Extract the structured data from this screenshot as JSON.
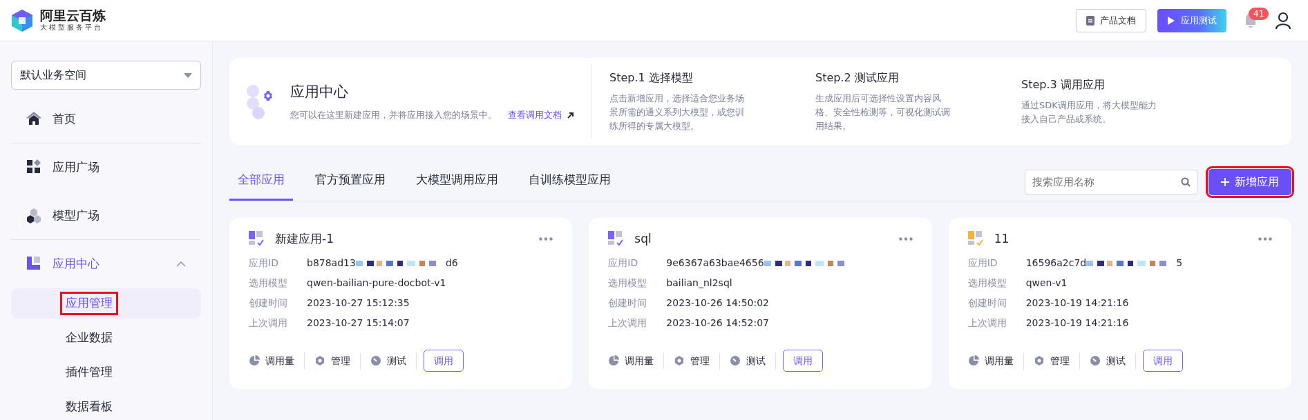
{
  "brand": {
    "name": "阿里云百炼",
    "tagline": "大模型服务平台"
  },
  "topbar": {
    "buttons": [
      {
        "label": "产品文档",
        "kind": "outline"
      },
      {
        "label": "应用测试",
        "kind": "gradient"
      }
    ],
    "notification_count": "41"
  },
  "sidebar": {
    "workspace": "默认业务空间",
    "items": [
      {
        "label": "首页",
        "kind": "home",
        "selected": false,
        "divider_after": true
      },
      {
        "label": "应用广场",
        "kind": "grid",
        "selected": false,
        "divider_after": false
      },
      {
        "label": "模型广场",
        "kind": "cubes",
        "selected": false,
        "divider_after": true
      },
      {
        "label": "应用中心",
        "kind": "app",
        "selected": true,
        "expanded": true,
        "divider_after": false,
        "children": [
          {
            "label": "应用管理",
            "selected": true,
            "annotated": true
          },
          {
            "label": "企业数据",
            "selected": false,
            "annotated": false
          },
          {
            "label": "插件管理",
            "selected": false,
            "annotated": false
          },
          {
            "label": "数据看板",
            "selected": false,
            "annotated": false
          }
        ]
      }
    ]
  },
  "intro": {
    "title": "应用中心",
    "description": "您可以在这里新建应用，并将应用接入您的场景中。",
    "link": "查看调用文档",
    "steps": [
      {
        "title": "Step.1 选择模型",
        "text": "点击新增应用，选择适合您业务场景所需的通义系列大模型，或您训练所得的专属大模型。"
      },
      {
        "title": "Step.2 测试应用",
        "text": "生成应用后可选择性设置内容风格、安全性检测等，可视化测试调用结果。"
      },
      {
        "title": "Step.3 调用应用",
        "text": "通过SDK调用应用，将大模型能力接入自己产品或系统。"
      }
    ]
  },
  "tabs": [
    {
      "label": "全部应用",
      "selected": true
    },
    {
      "label": "官方预置应用",
      "selected": false
    },
    {
      "label": "大模型调用应用",
      "selected": false
    },
    {
      "label": "自训练模型应用",
      "selected": false
    }
  ],
  "search": {
    "placeholder": "搜索应用名称"
  },
  "new_button": {
    "label": "新增应用",
    "annotated": true
  },
  "apps": [
    {
      "name": "新建应用-1",
      "color": "#7b61ff",
      "fields": [
        {
          "label": "应用ID",
          "value": "b878ad13",
          "masked": true,
          "tail": "d6"
        },
        {
          "label": "选用模型",
          "value": "qwen-bailian-pure-docbot-v1",
          "masked": false
        },
        {
          "label": "创建时间",
          "value": "2023-10-27 15:12:35",
          "masked": false
        },
        {
          "label": "上次调用",
          "value": "2023-10-27 15:14:07",
          "masked": false
        }
      ],
      "actions": [
        {
          "kind": "usage",
          "label": "调用量"
        },
        {
          "kind": "manage",
          "label": "管理"
        },
        {
          "kind": "test",
          "label": "测试"
        }
      ],
      "invoke": "调用"
    },
    {
      "name": "sql",
      "color": "#7b61ff",
      "fields": [
        {
          "label": "应用ID",
          "value": "9e6367a63bae4656",
          "masked": true
        },
        {
          "label": "选用模型",
          "value": "bailian_nl2sql",
          "masked": false
        },
        {
          "label": "创建时间",
          "value": "2023-10-26 14:50:02",
          "masked": false
        },
        {
          "label": "上次调用",
          "value": "2023-10-26 14:52:07",
          "masked": false
        }
      ],
      "actions": [
        {
          "kind": "usage",
          "label": "调用量"
        },
        {
          "kind": "manage",
          "label": "管理"
        },
        {
          "kind": "test",
          "label": "测试"
        }
      ],
      "invoke": "调用"
    },
    {
      "name": "11",
      "color": "#f5b335",
      "fields": [
        {
          "label": "应用ID",
          "value": "16596a2c7d",
          "masked": true,
          "tail": "5"
        },
        {
          "label": "选用模型",
          "value": "qwen-v1",
          "masked": false
        },
        {
          "label": "创建时间",
          "value": "2023-10-19 14:21:16",
          "masked": false
        },
        {
          "label": "上次调用",
          "value": "2023-10-19 14:21:16",
          "masked": false
        }
      ],
      "actions": [
        {
          "kind": "usage",
          "label": "调用量"
        },
        {
          "kind": "manage",
          "label": "管理"
        },
        {
          "kind": "test",
          "label": "测试"
        }
      ],
      "invoke": "调用"
    }
  ]
}
